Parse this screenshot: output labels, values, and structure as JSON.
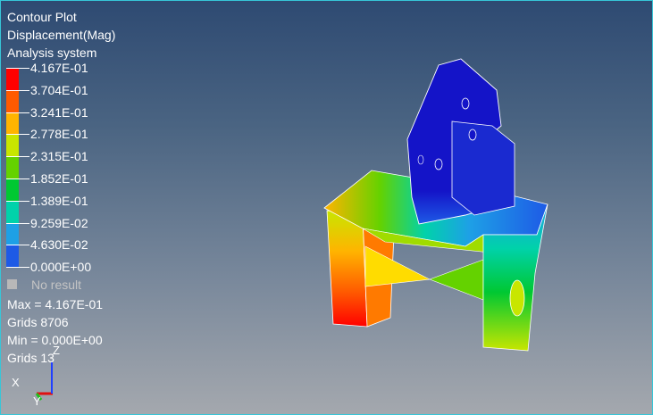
{
  "header": {
    "plot_type": "Contour Plot",
    "result": "Displacement(Mag)",
    "system": "Analysis system"
  },
  "legend": {
    "levels": [
      "4.167E-01",
      "3.704E-01",
      "3.241E-01",
      "2.778E-01",
      "2.315E-01",
      "1.852E-01",
      "1.389E-01",
      "9.259E-02",
      "4.630E-02",
      "0.000E+00"
    ],
    "colors": [
      "#ff0000",
      "#ff5a00",
      "#ffb400",
      "#c8e600",
      "#64d200",
      "#00c832",
      "#00d2aa",
      "#1ea0e6",
      "#1e5ae6",
      "#1414c8"
    ],
    "no_result_label": "No result",
    "no_result_color": "#b8b8b8"
  },
  "stats": {
    "max": "Max = 4.167E-01",
    "max_grids": "Grids 8706",
    "min": "Min = 0.000E+00",
    "min_grids": "Grids 13"
  },
  "triad": {
    "x_label": "X",
    "y_label": "Y",
    "z_label": "Z",
    "x_color": "#e01010",
    "y_color": "#20c020",
    "z_color": "#2040ff"
  },
  "viewport": {
    "border_color": "#36c6d8"
  }
}
